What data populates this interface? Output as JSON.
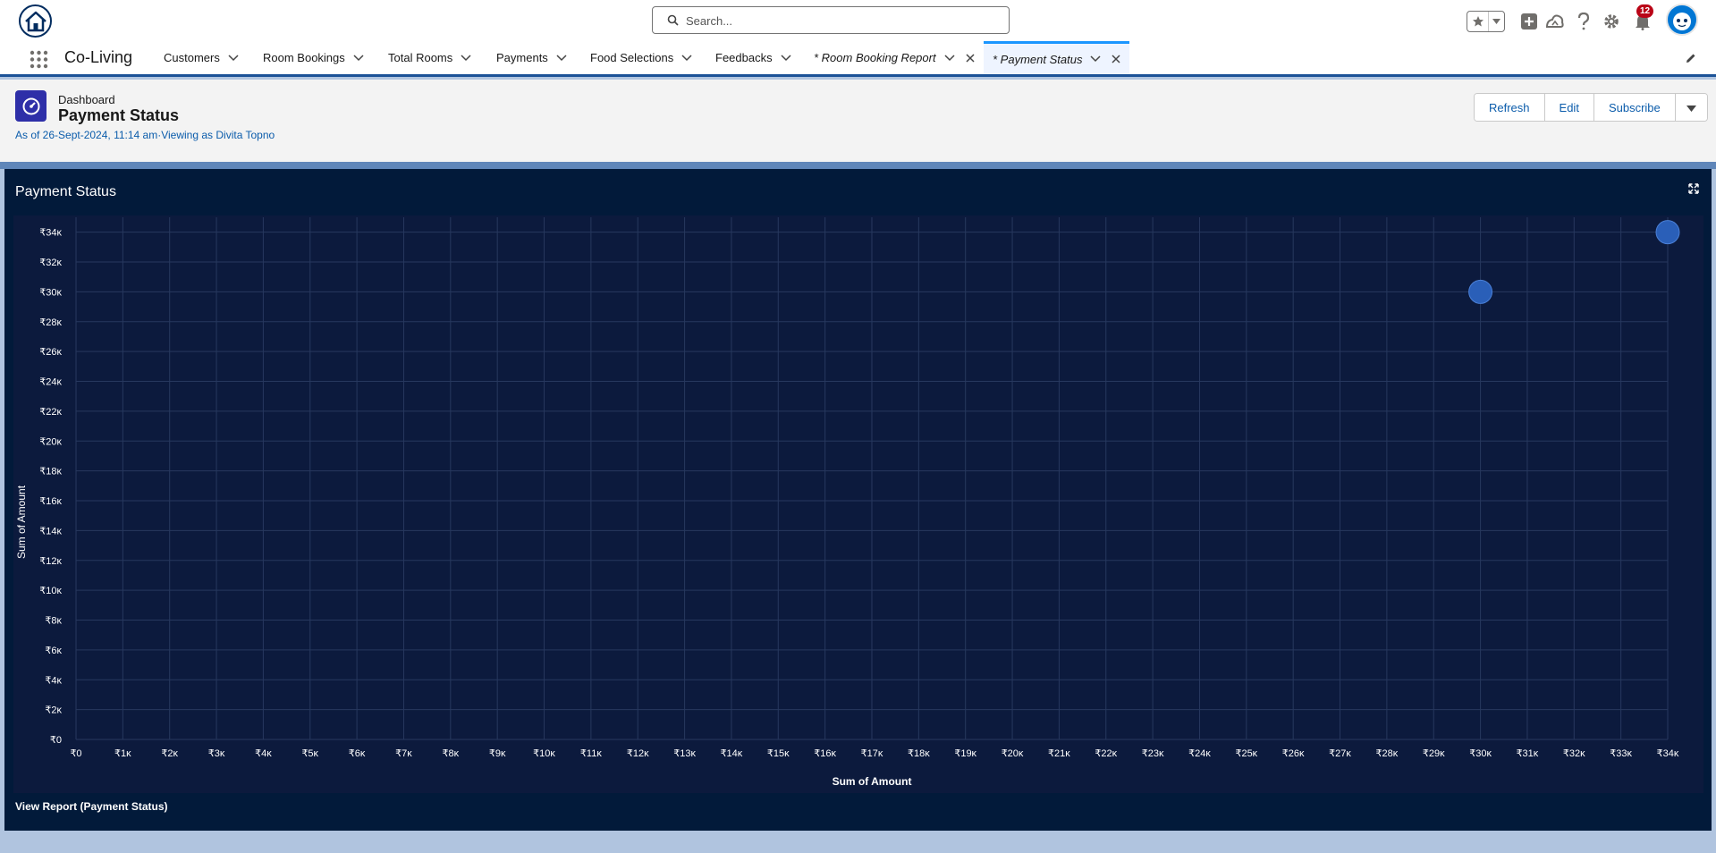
{
  "header": {
    "search_placeholder": "Search...",
    "notification_count": "12",
    "icons": [
      "home-logo",
      "search-icon",
      "star-icon",
      "chevron-down-icon",
      "add-icon",
      "trailhead-icon",
      "help-icon",
      "gear-icon",
      "bell-icon",
      "avatar"
    ]
  },
  "nav": {
    "app_name": "Co-Living",
    "items": [
      {
        "label": "Customers"
      },
      {
        "label": "Room Bookings"
      },
      {
        "label": "Total Rooms"
      },
      {
        "label": "Payments"
      },
      {
        "label": "Food Selections"
      },
      {
        "label": "Feedbacks"
      },
      {
        "label": "* Room Booking Report"
      },
      {
        "label": "* Payment Status"
      }
    ]
  },
  "dashboard": {
    "type_label": "Dashboard",
    "title": "Payment Status",
    "meta": "As of 26-Sept-2024, 11:14 am·Viewing as Divita Topno",
    "buttons": {
      "refresh": "Refresh",
      "edit": "Edit",
      "subscribe": "Subscribe"
    }
  },
  "widget": {
    "title": "Payment Status",
    "view_report": "View Report (Payment Status)"
  },
  "colors": {
    "brand_blue": "#0b5cab",
    "nav_accent": "#1b96ff",
    "chart_bg": "#0c1a3d",
    "widget_bg": "#021a3a",
    "point_fill": "#2a5fb8",
    "notification_red": "#ba0517"
  },
  "chart_data": {
    "type": "scatter",
    "title": "Payment Status",
    "xlabel": "Sum of Amount",
    "ylabel": "Sum of Amount",
    "xlim": [
      0,
      34000
    ],
    "ylim": [
      0,
      35000
    ],
    "x_ticks": [
      0,
      1000,
      2000,
      3000,
      4000,
      5000,
      6000,
      7000,
      8000,
      9000,
      10000,
      11000,
      12000,
      13000,
      14000,
      15000,
      16000,
      17000,
      18000,
      19000,
      20000,
      21000,
      22000,
      23000,
      24000,
      25000,
      26000,
      27000,
      28000,
      29000,
      30000,
      31000,
      32000,
      33000,
      34000
    ],
    "x_tick_labels": [
      "₹0",
      "₹1ĸ",
      "₹2ĸ",
      "₹3ĸ",
      "₹4ĸ",
      "₹5ĸ",
      "₹6ĸ",
      "₹7ĸ",
      "₹8ĸ",
      "₹9ĸ",
      "₹10ĸ",
      "₹11ĸ",
      "₹12ĸ",
      "₹13ĸ",
      "₹14ĸ",
      "₹15ĸ",
      "₹16ĸ",
      "₹17ĸ",
      "₹18ĸ",
      "₹19ĸ",
      "₹20ĸ",
      "₹21ĸ",
      "₹22ĸ",
      "₹23ĸ",
      "₹24ĸ",
      "₹25ĸ",
      "₹26ĸ",
      "₹27ĸ",
      "₹28ĸ",
      "₹29ĸ",
      "₹30ĸ",
      "₹31ĸ",
      "₹32ĸ",
      "₹33ĸ",
      "₹34ĸ"
    ],
    "y_ticks": [
      0,
      2000,
      4000,
      6000,
      8000,
      10000,
      12000,
      14000,
      16000,
      18000,
      20000,
      22000,
      24000,
      26000,
      28000,
      30000,
      32000,
      34000
    ],
    "y_tick_labels": [
      "₹0",
      "₹2ĸ",
      "₹4ĸ",
      "₹6ĸ",
      "₹8ĸ",
      "₹10ĸ",
      "₹12ĸ",
      "₹14ĸ",
      "₹16ĸ",
      "₹18ĸ",
      "₹20ĸ",
      "₹22ĸ",
      "₹24ĸ",
      "₹26ĸ",
      "₹28ĸ",
      "₹30ĸ",
      "₹32ĸ",
      "₹34ĸ"
    ],
    "grid": true,
    "points": [
      {
        "x": 30000,
        "y": 30000
      },
      {
        "x": 34000,
        "y": 34000
      }
    ]
  }
}
